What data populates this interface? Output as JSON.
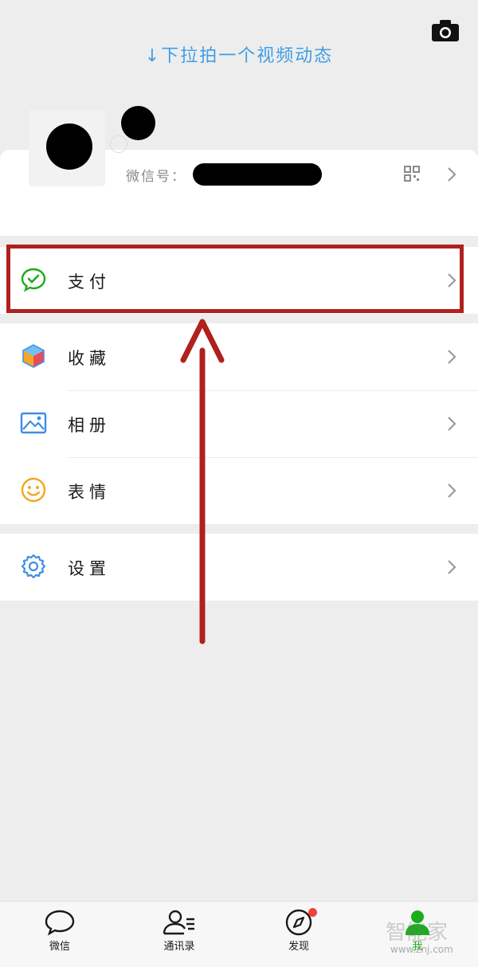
{
  "header": {
    "pull_hint": "↓下拉拍一个视频动态",
    "camera_icon": "camera-icon"
  },
  "profile": {
    "wechat_id_label": "微信号：",
    "qr_icon": "qr-code-icon"
  },
  "menu": {
    "pay": {
      "label": "支付",
      "icon": "wechat-pay-icon",
      "color": "#1aad19"
    },
    "favorites": {
      "label": "收藏",
      "icon": "cube-icon"
    },
    "album": {
      "label": "相册",
      "icon": "picture-icon",
      "color": "#3f8ee6"
    },
    "stickers": {
      "label": "表情",
      "icon": "smiley-icon",
      "color": "#f5a623"
    },
    "settings": {
      "label": "设置",
      "icon": "gear-icon",
      "color": "#3f8ee6"
    }
  },
  "annotation": {
    "color": "#b0211d"
  },
  "tabs": [
    {
      "label": "微信",
      "icon": "chat-bubble-icon"
    },
    {
      "label": "通讯录",
      "icon": "contacts-icon"
    },
    {
      "label": "发现",
      "icon": "compass-icon",
      "badge": true
    },
    {
      "label": "我",
      "icon": "person-icon",
      "active": true,
      "color": "#1aad19"
    }
  ],
  "watermark": {
    "text": "智能家",
    "url": "www.znj.com"
  }
}
